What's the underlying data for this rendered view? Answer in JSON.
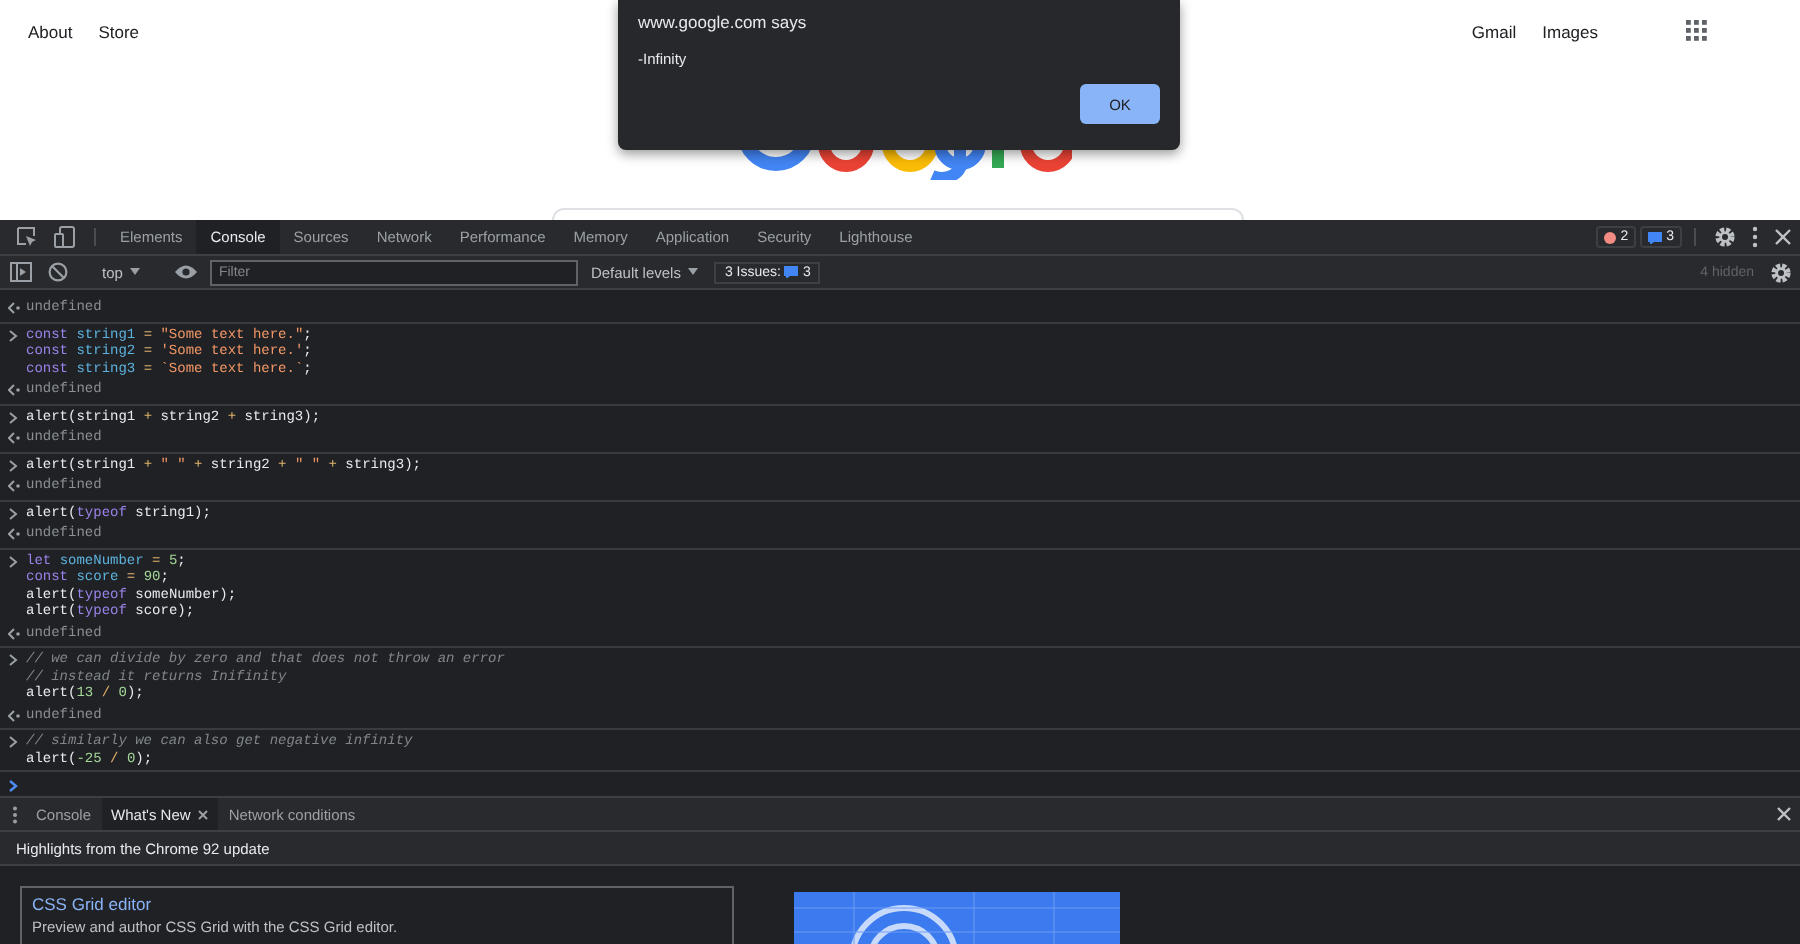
{
  "page": {
    "links_left": [
      "About",
      "Store"
    ],
    "links_right": [
      "Gmail",
      "Images"
    ]
  },
  "dialog": {
    "title": "www.google.com says",
    "message": "-Infinity",
    "button": "OK"
  },
  "devtools": {
    "tabs": [
      {
        "label": "Elements",
        "selected": false
      },
      {
        "label": "Console",
        "selected": true
      },
      {
        "label": "Sources",
        "selected": false
      },
      {
        "label": "Network",
        "selected": false
      },
      {
        "label": "Performance",
        "selected": false
      },
      {
        "label": "Memory",
        "selected": false
      },
      {
        "label": "Application",
        "selected": false
      },
      {
        "label": "Security",
        "selected": false
      },
      {
        "label": "Lighthouse",
        "selected": false
      }
    ],
    "error_count": "2",
    "issue_count": "3",
    "toolbar": {
      "context": "top",
      "filter_placeholder": "Filter",
      "levels": "Default levels",
      "issues_label": "3 Issues:",
      "issues_count": "3",
      "hidden": "4 hidden"
    },
    "console": [
      {
        "output": "undefined"
      },
      {
        "input": [
          [
            {
              "kind": "kw",
              "text": "const "
            },
            {
              "kind": "var",
              "text": "string1"
            },
            {
              "kind": "op",
              "text": " = "
            },
            {
              "kind": "str",
              "text": "\"Some text here.\""
            },
            {
              "kind": "plain",
              "text": ";"
            }
          ],
          [
            {
              "kind": "kw",
              "text": "const "
            },
            {
              "kind": "var",
              "text": "string2"
            },
            {
              "kind": "op",
              "text": " = "
            },
            {
              "kind": "str",
              "text": "'Some text here.'"
            },
            {
              "kind": "plain",
              "text": ";"
            }
          ],
          [
            {
              "kind": "kw",
              "text": "const "
            },
            {
              "kind": "var",
              "text": "string3"
            },
            {
              "kind": "op",
              "text": " = "
            },
            {
              "kind": "str",
              "text": "`Some text here.`"
            },
            {
              "kind": "plain",
              "text": ";"
            }
          ]
        ],
        "output": "undefined"
      },
      {
        "input": [
          [
            {
              "kind": "plain",
              "text": "alert(string1 "
            },
            {
              "kind": "op",
              "text": "+"
            },
            {
              "kind": "plain",
              "text": " string2 "
            },
            {
              "kind": "op",
              "text": "+"
            },
            {
              "kind": "plain",
              "text": " string3);"
            }
          ]
        ],
        "output": "undefined"
      },
      {
        "input": [
          [
            {
              "kind": "plain",
              "text": "alert(string1 "
            },
            {
              "kind": "op",
              "text": "+"
            },
            {
              "kind": "str",
              "text": " \" \" "
            },
            {
              "kind": "op",
              "text": "+"
            },
            {
              "kind": "plain",
              "text": " string2 "
            },
            {
              "kind": "op",
              "text": "+"
            },
            {
              "kind": "str",
              "text": " \" \" "
            },
            {
              "kind": "op",
              "text": "+"
            },
            {
              "kind": "plain",
              "text": " string3);"
            }
          ]
        ],
        "output": "undefined"
      },
      {
        "input": [
          [
            {
              "kind": "plain",
              "text": "alert("
            },
            {
              "kind": "kw",
              "text": "typeof"
            },
            {
              "kind": "plain",
              "text": " string1);"
            }
          ]
        ],
        "output": "undefined"
      },
      {
        "input": [
          [
            {
              "kind": "kw",
              "text": "let "
            },
            {
              "kind": "var",
              "text": "someNumber"
            },
            {
              "kind": "op",
              "text": " = "
            },
            {
              "kind": "num",
              "text": "5"
            },
            {
              "kind": "plain",
              "text": ";"
            }
          ],
          [
            {
              "kind": "kw",
              "text": "const "
            },
            {
              "kind": "var",
              "text": "score"
            },
            {
              "kind": "op",
              "text": " = "
            },
            {
              "kind": "num",
              "text": "90"
            },
            {
              "kind": "plain",
              "text": ";"
            }
          ],
          [
            {
              "kind": "plain",
              "text": "alert("
            },
            {
              "kind": "kw",
              "text": "typeof"
            },
            {
              "kind": "plain",
              "text": " someNumber);"
            }
          ],
          [
            {
              "kind": "plain",
              "text": "alert("
            },
            {
              "kind": "kw",
              "text": "typeof"
            },
            {
              "kind": "plain",
              "text": " score);"
            }
          ]
        ],
        "output": "undefined"
      },
      {
        "input": [
          [
            {
              "kind": "com",
              "text": "// we can divide by zero and that does not throw an error"
            }
          ],
          [
            {
              "kind": "com",
              "text": "// instead it returns Inifinity"
            }
          ],
          [
            {
              "kind": "plain",
              "text": "alert("
            },
            {
              "kind": "num",
              "text": "13"
            },
            {
              "kind": "op",
              "text": " / "
            },
            {
              "kind": "num",
              "text": "0"
            },
            {
              "kind": "plain",
              "text": ");"
            }
          ]
        ],
        "output": "undefined"
      },
      {
        "input": [
          [
            {
              "kind": "com",
              "text": "// similarly we can also get negative infinity"
            }
          ],
          [
            {
              "kind": "plain",
              "text": "alert("
            },
            {
              "kind": "num",
              "text": "-25"
            },
            {
              "kind": "op",
              "text": " / "
            },
            {
              "kind": "num",
              "text": "0"
            },
            {
              "kind": "plain",
              "text": ");"
            }
          ]
        ]
      }
    ]
  },
  "drawer": {
    "tabs": [
      {
        "label": "Console",
        "selected": false,
        "closable": false
      },
      {
        "label": "What's New",
        "selected": true,
        "closable": true
      },
      {
        "label": "Network conditions",
        "selected": false,
        "closable": false
      }
    ],
    "heading": "Highlights from the Chrome 92 update",
    "card": {
      "title": "CSS Grid editor",
      "description": "Preview and author CSS Grid with the CSS Grid editor."
    }
  }
}
